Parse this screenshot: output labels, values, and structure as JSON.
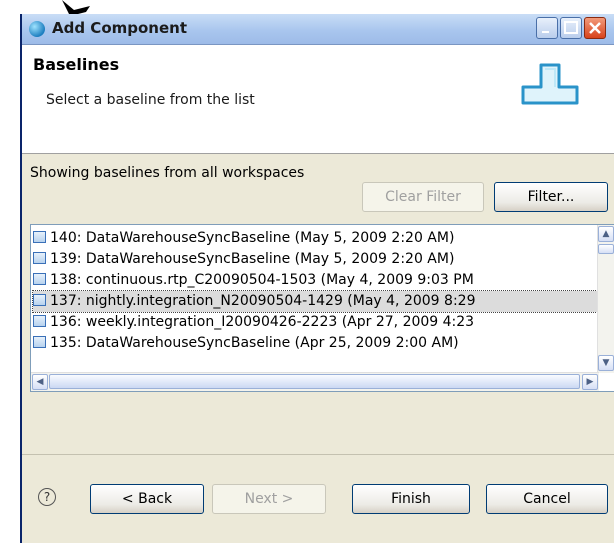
{
  "window": {
    "title": "Add Component",
    "icon": "component-icon"
  },
  "header": {
    "title": "Baselines",
    "description": "Select a baseline from the list",
    "graphic": "baseline-banner-icon"
  },
  "filter": {
    "info": "Showing baselines from all workspaces",
    "clear_label": "Clear Filter",
    "filter_label": "Filter..."
  },
  "baselines": [
    "140: DataWarehouseSyncBaseline (May 5, 2009 2:20 AM)",
    "139: DataWarehouseSyncBaseline (May 5, 2009 2:20 AM)",
    "138: continuous.rtp_C20090504-1503 (May 4, 2009 9:03 PM",
    "137: nightly.integration_N20090504-1429 (May 4, 2009 8:29",
    "136: weekly.integration_I20090426-2223 (Apr 27, 2009 4:23",
    "135: DataWarehouseSyncBaseline (Apr 25, 2009 2:00 AM)"
  ],
  "selected_index": 3,
  "footer": {
    "back_label": "< Back",
    "next_label": "Next >",
    "finish_label": "Finish",
    "cancel_label": "Cancel"
  },
  "colors": {
    "titlebar": "#a9c6ee",
    "dialog_bg": "#ece9d8",
    "list_border": "#7f9db9",
    "close_button": "#d8431c"
  }
}
